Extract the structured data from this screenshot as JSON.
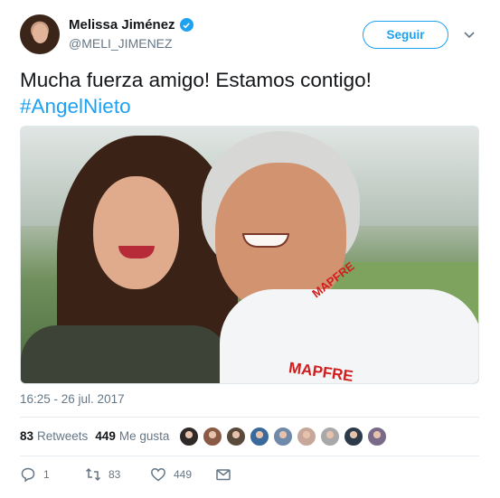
{
  "author": {
    "name": "Melissa Jiménez",
    "handle": "@MELI_JIMENEZ",
    "verified": true
  },
  "follow_button": {
    "label": "Seguir"
  },
  "tweet": {
    "text": "Mucha fuerza amigo! Estamos contigo!",
    "hashtag": "#AngelNieto",
    "image": {
      "brand_text_1": "MAPFRE",
      "brand_text_2": "MAPFRE"
    },
    "timestamp": "16:25 - 26 jul. 2017"
  },
  "stats": {
    "retweets_count": "83",
    "retweets_label": "Retweets",
    "likes_count": "449",
    "likes_label": "Me gusta",
    "liker_avatar_colors": [
      "#2f2a27",
      "#8a5a45",
      "#5a4a3c",
      "#3a6a9c",
      "#6e8aa8",
      "#c7a79a",
      "#a8a8a8",
      "#2d3a4a",
      "#7a6a8a"
    ]
  },
  "actions": {
    "reply_count": "1",
    "retweet_count": "83",
    "like_count": "449"
  },
  "colors": {
    "accent": "#1da1f2",
    "secondary_text": "#657786",
    "primary_text": "#14171a"
  }
}
